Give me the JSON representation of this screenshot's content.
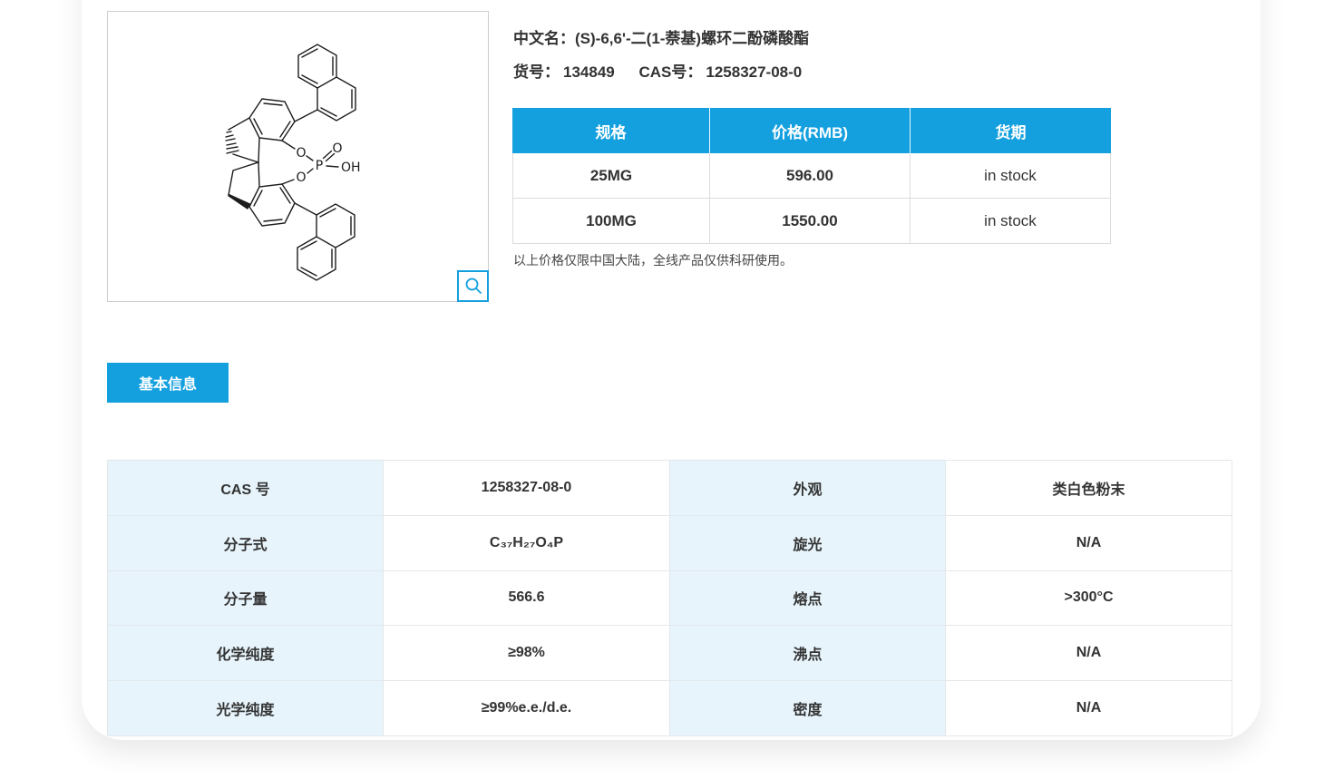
{
  "product": {
    "name_label": "中文名：",
    "name": "(S)-6,6'-二(1-萘基)螺环二酚磷酸酯",
    "catalog_label": "货号：",
    "catalog_no": "134849",
    "cas_label": "CAS号：",
    "cas_no": "1258327-08-0"
  },
  "price_table": {
    "headers": [
      "规格",
      "价格(RMB)",
      "货期"
    ],
    "rows": [
      {
        "spec": "25MG",
        "price": "596.00",
        "availability": "in stock"
      },
      {
        "spec": "100MG",
        "price": "1550.00",
        "availability": "in stock"
      }
    ]
  },
  "price_note": "以上价格仅限中国大陆，全线产品仅供科研使用。",
  "tabs": {
    "basic_info": "基本信息"
  },
  "info_table": {
    "rows": [
      {
        "label1": "CAS 号",
        "value1": "1258327-08-0",
        "label2": "外观",
        "value2": "类白色粉末"
      },
      {
        "label1": "分子式",
        "value1": "C₃₇H₂₇O₄P",
        "label2": "旋光",
        "value2": "N/A"
      },
      {
        "label1": "分子量",
        "value1": "566.6",
        "label2": "熔点",
        "value2": ">300°C"
      },
      {
        "label1": "化学纯度",
        "value1": "≥98%",
        "label2": "沸点",
        "value2": "N/A"
      },
      {
        "label1": "光学纯度",
        "value1": "≥99%e.e./d.e.",
        "label2": "密度",
        "value2": "N/A"
      }
    ]
  },
  "structure": {
    "atoms": {
      "o_upper": "O",
      "o_lower": "O",
      "p": "P",
      "o_double": "O",
      "oh": "OH"
    }
  },
  "colors": {
    "accent_blue": "#14A0DF",
    "label_cell_bg": "#E7F4FB"
  }
}
